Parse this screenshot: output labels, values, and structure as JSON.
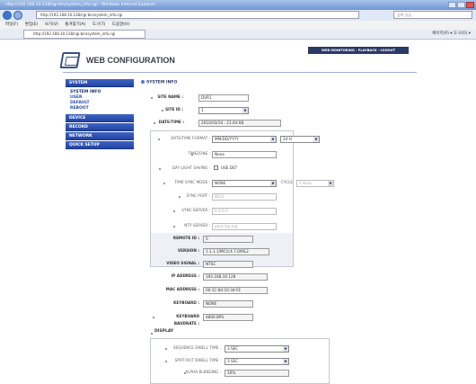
{
  "browser": {
    "title": "http://192.168.10.128/cgi-bin/system_info.cgi - Windows Internet Explorer",
    "address": "http://192.168.10.128/cgi-bin/system_info.cgi",
    "search_placeholder": "검색 공급",
    "menu": [
      "파일(F)",
      "편집(E)",
      "보기(V)",
      "즐겨찾기(A)",
      "도구(T)",
      "도움말(H)"
    ],
    "tab_title": "http://192.168.10.128/cgi-bin/system_info.cgi",
    "tab_tools": "페이지(P) ▾  도구(O) ▾"
  },
  "header": {
    "top_nav": "WEB MONITORING  ·  PLAYBACK  ·  LOGOUT",
    "title": "WEB CONFIGURATION"
  },
  "sidebar": {
    "system": "SYSTEM",
    "system_items": [
      "SYSTEM INFO",
      "USER",
      "DEFAULT",
      "REBOOT"
    ],
    "device": "DEVICE",
    "record": "RECORD",
    "network": "NETWORK",
    "quick_setup": "QUICK SETUP"
  },
  "system_info": {
    "section_title": "SYSTEM INFO",
    "site_name_label": "SITE NAME :",
    "site_name": "DVR1",
    "site_id_label": "SITE ID :",
    "site_id": "1",
    "date_time_label": "DATE/TIME :",
    "date_time": "2010/03/10 - 21:44:08",
    "date_format_label": "DATE/TIME FORMAT :",
    "date_format": "MM/DD/YYYY",
    "hour_format": "24 H",
    "timezone_label": "TIMEZONE :",
    "timezone": "None",
    "daylight_label": "DAY LIGHT SAVING :",
    "use_dst": "USE DST",
    "time_sync_label": "TIME SYNC MODE :",
    "time_sync": "NONE",
    "cycle_label": "CYCLE",
    "cycle": "1 Hour",
    "sync_port_label": "SYNC PORT :",
    "sync_port": "8022",
    "sync_server_label": "SYNC SERVER :",
    "sync_server": "0.0.0.0",
    "ntp_server_label": "NTP SERVER :",
    "ntp_server": "pool.ntp.org",
    "remote_id_label": "REMOTE ID :",
    "remote_id": "0",
    "version_label": "VERSION :",
    "version": "1.1.1.1/MCU:4.7.0/ML2",
    "video_signal_label": "VIDEO SIGNAL :",
    "video_signal": "NTSC",
    "ip_label": "IP ADDRESS :",
    "ip": "192.168.10.128",
    "mac_label": "MAC ADDRESS :",
    "mac": "00:1C:84:10:34:FE",
    "keyboard_label": "KEYBOARD :",
    "keyboard": "NONE",
    "baud_label": "KEYBOARD BAUDRATE :",
    "baud": "4800 BPS"
  },
  "display": {
    "title": "DISPLAY",
    "seq_dwell_label": "SEQUENCE DWELL TIME :",
    "seq_dwell": "3 SEC",
    "spot_dwell_label": "SPOT-OUT DWELL TIME :",
    "spot_dwell": "3 SEC",
    "alpha_label": "ALPHA BLENDING :",
    "alpha": "10%"
  }
}
